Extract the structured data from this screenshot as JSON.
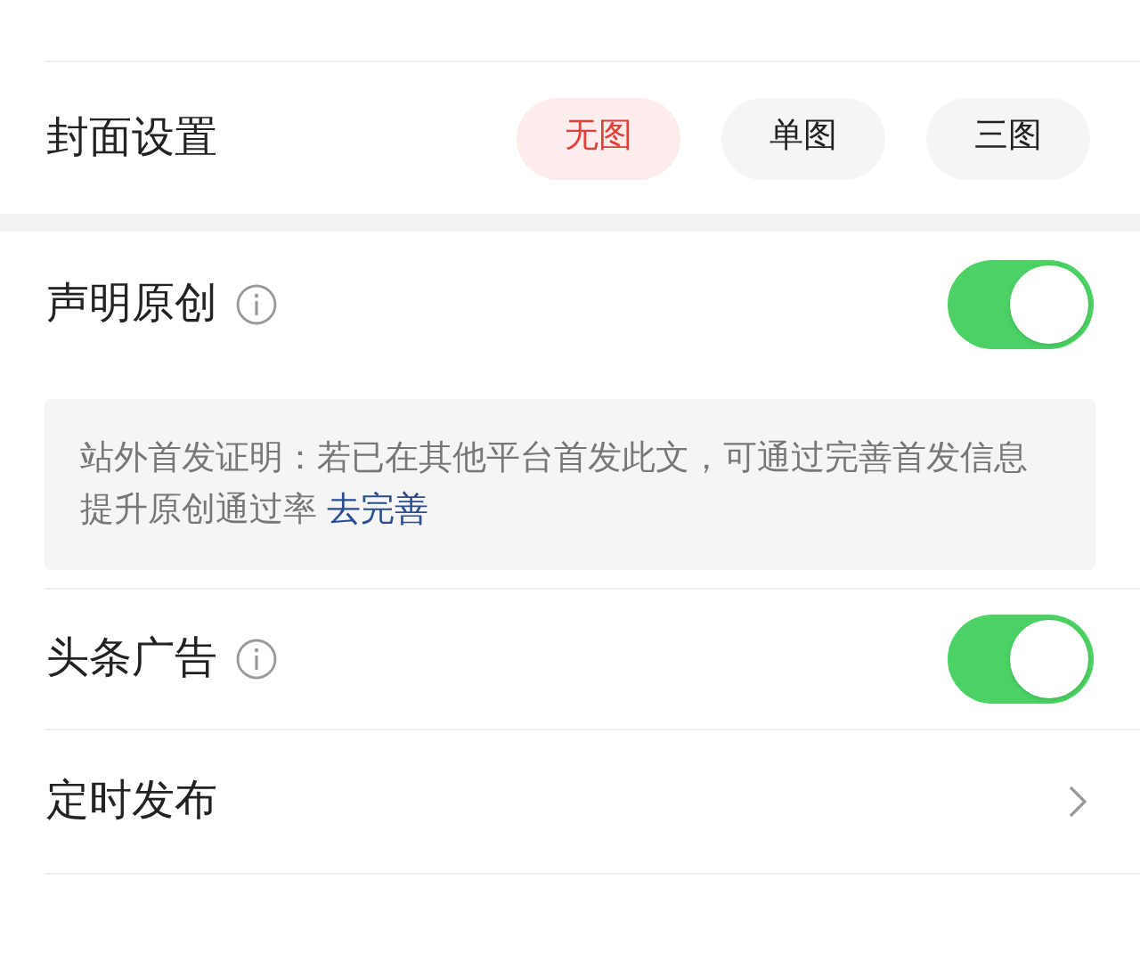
{
  "cover": {
    "label": "封面设置",
    "options": [
      {
        "label": "无图",
        "selected": true
      },
      {
        "label": "单图",
        "selected": false
      },
      {
        "label": "三图",
        "selected": false
      }
    ]
  },
  "original": {
    "label": "声明原创",
    "on": true
  },
  "notice": {
    "text": "站外首发证明：若已在其他平台首发此文，可通过完善首发信息提升原创通过率",
    "link": "去完善"
  },
  "ads": {
    "label": "头条广告",
    "on": true
  },
  "schedule": {
    "label": "定时发布"
  }
}
